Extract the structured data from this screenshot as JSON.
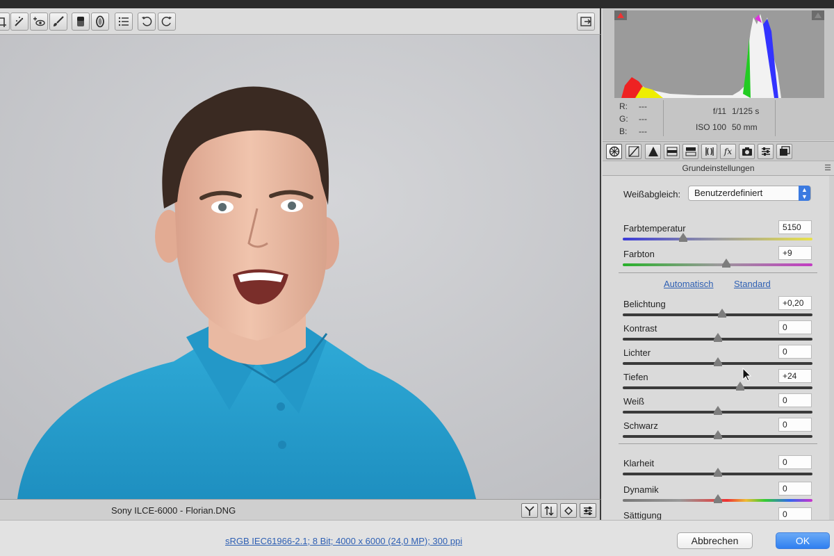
{
  "colors": {
    "accent": "#2f7ff0",
    "link": "#2d5fb3",
    "panel": "#d2d2d2",
    "preview_bg": "#c7c8cb",
    "shirt": "#2ba2d1"
  },
  "toolbar": {
    "tools": [
      {
        "icon": "crop-icon"
      },
      {
        "icon": "spot-removal-icon"
      },
      {
        "icon": "red-eye-icon"
      },
      {
        "icon": "adjustment-brush-icon"
      },
      {
        "icon": "graduated-filter-icon"
      },
      {
        "icon": "radial-filter-icon"
      },
      {
        "icon": "list-icon"
      },
      {
        "icon": "rotate-ccw-icon"
      },
      {
        "icon": "rotate-cw-icon"
      }
    ],
    "right_icon": "fullscreen-icon"
  },
  "status": {
    "filename": "Sony ILCE-6000 - Florian.DNG",
    "buttons": [
      "y-compare-icon",
      "swap-icon",
      "copy-settings-icon",
      "preferences-icon"
    ]
  },
  "histogram": {
    "r_label": "R:",
    "r_value": "---",
    "g_label": "G:",
    "g_value": "---",
    "b_label": "B:",
    "b_value": "---",
    "aperture": "f/11",
    "shutter": "1/125 s",
    "iso": "ISO 100",
    "focal": "50 mm"
  },
  "tabs": [
    {
      "icon": "basic-icon",
      "active": true
    },
    {
      "icon": "tone-curve-icon"
    },
    {
      "icon": "detail-icon"
    },
    {
      "icon": "hsl-icon"
    },
    {
      "icon": "split-toning-icon"
    },
    {
      "icon": "lens-corrections-icon"
    },
    {
      "icon": "fx-icon",
      "text": "fx"
    },
    {
      "icon": "camera-calibration-icon"
    },
    {
      "icon": "presets-icon"
    },
    {
      "icon": "snapshots-icon"
    }
  ],
  "section": {
    "title": "Grundeinstellungen"
  },
  "white_balance": {
    "label": "Weißabgleich:",
    "value": "Benutzerdefiniert"
  },
  "links": {
    "auto": "Automatisch",
    "default": "Standard"
  },
  "sliders": [
    {
      "id": "farbtemperatur",
      "label": "Farbtemperatur",
      "value": "5150",
      "pos": 0.32,
      "track": "temp"
    },
    {
      "id": "farbton",
      "label": "Farbton",
      "value": "+9",
      "pos": 0.545,
      "track": "tint"
    },
    {
      "id": "belichtung",
      "label": "Belichtung",
      "value": "+0,20",
      "pos": 0.525,
      "track": "dark"
    },
    {
      "id": "kontrast",
      "label": "Kontrast",
      "value": "0",
      "pos": 0.5,
      "track": "dark"
    },
    {
      "id": "lichter",
      "label": "Lichter",
      "value": "0",
      "pos": 0.5,
      "track": "dark"
    },
    {
      "id": "tiefen",
      "label": "Tiefen",
      "value": "+24",
      "pos": 0.618,
      "track": "dark"
    },
    {
      "id": "weiss",
      "label": "Weiß",
      "value": "0",
      "pos": 0.5,
      "track": "dark"
    },
    {
      "id": "schwarz",
      "label": "Schwarz",
      "value": "0",
      "pos": 0.5,
      "track": "dark"
    },
    {
      "id": "klarheit",
      "label": "Klarheit",
      "value": "0",
      "pos": 0.5,
      "track": "dark"
    },
    {
      "id": "dynamik",
      "label": "Dynamik",
      "value": "0",
      "pos": 0.5,
      "track": "rainbow"
    },
    {
      "id": "saettigung",
      "label": "Sättigung",
      "value": "0",
      "pos": 0.5,
      "track": "rainbow"
    }
  ],
  "bottom": {
    "info": "sRGB IEC61966-2.1; 8 Bit; 4000 x 6000 (24,0 MP); 300 ppi",
    "cancel": "Abbrechen",
    "ok": "OK"
  }
}
